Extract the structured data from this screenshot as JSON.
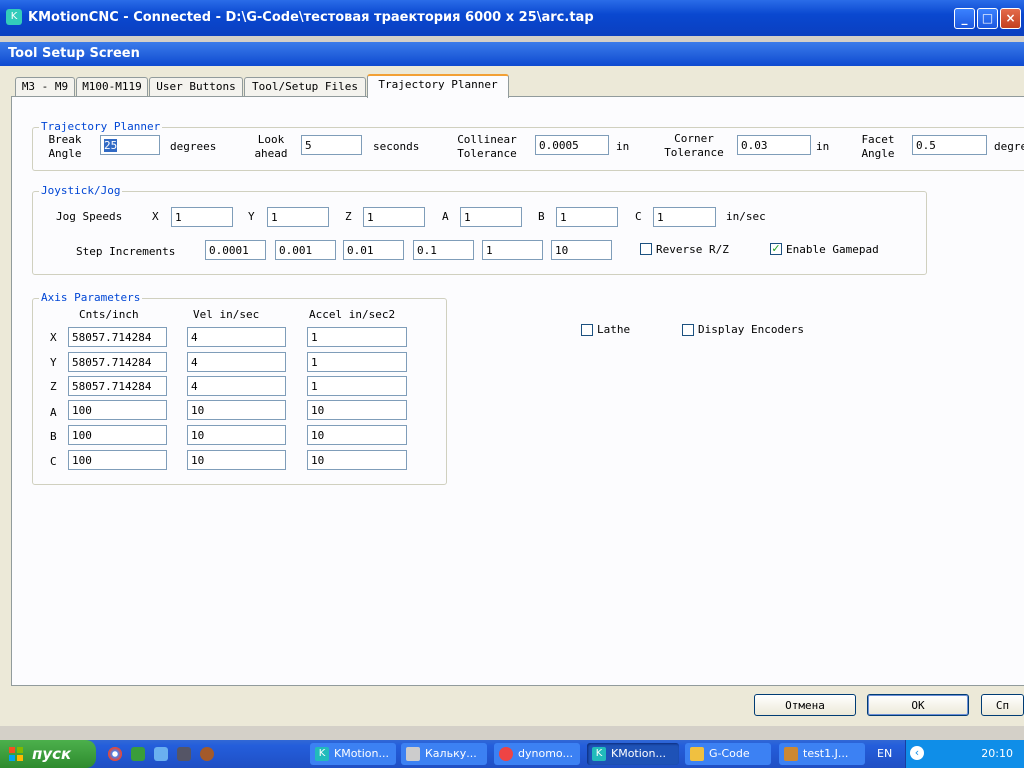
{
  "window": {
    "title": "KMotionCNC - Connected - D:\\G-Code\\тестовая траектория 6000 x 25\\arc.tap"
  },
  "dialog": {
    "title": "Tool Setup Screen"
  },
  "tabs": [
    "M3 - M9",
    "M100-M119",
    "User Buttons",
    "Tool/Setup Files",
    "Trajectory Planner"
  ],
  "trajectory": {
    "group_label": "Trajectory Planner",
    "break_angle_label": "Break\nAngle",
    "break_angle": "25",
    "break_angle_unit": "degrees",
    "look_ahead_label": "Look\nahead",
    "look_ahead": "5",
    "look_ahead_unit": "seconds",
    "collinear_label": "Collinear\nTolerance",
    "collinear": "0.0005",
    "collinear_unit": "in",
    "corner_label": "Corner\nTolerance",
    "corner": "0.03",
    "corner_unit": "in",
    "facet_label": "Facet\nAngle",
    "facet": "0.5",
    "facet_unit": "degrees"
  },
  "joystick": {
    "group_label": "Joystick/Jog",
    "jog_speeds_label": "Jog Speeds",
    "axes": [
      "X",
      "Y",
      "Z",
      "A",
      "B",
      "C"
    ],
    "speeds": [
      "1",
      "1",
      "1",
      "1",
      "1",
      "1"
    ],
    "speed_unit": "in/sec",
    "step_label": "Step Increments",
    "steps": [
      "0.0001",
      "0.001",
      "0.01",
      "0.1",
      "1",
      "10"
    ],
    "reverse_label": "Reverse R/Z",
    "reverse_checked": false,
    "gamepad_label": "Enable Gamepad",
    "gamepad_checked": true
  },
  "axis_params": {
    "group_label": "Axis Parameters",
    "col_cnts": "Cnts/inch",
    "col_vel": "Vel in/sec",
    "col_accel": "Accel in/sec2",
    "rows": [
      {
        "axis": "X",
        "cnts": "58057.714284",
        "vel": "4",
        "accel": "1"
      },
      {
        "axis": "Y",
        "cnts": "58057.714284",
        "vel": "4",
        "accel": "1"
      },
      {
        "axis": "Z",
        "cnts": "58057.714284",
        "vel": "4",
        "accel": "1"
      },
      {
        "axis": "A",
        "cnts": "100",
        "vel": "10",
        "accel": "10"
      },
      {
        "axis": "B",
        "cnts": "100",
        "vel": "10",
        "accel": "10"
      },
      {
        "axis": "C",
        "cnts": "100",
        "vel": "10",
        "accel": "10"
      }
    ]
  },
  "options": {
    "lathe_label": "Lathe",
    "lathe_checked": false,
    "encoders_label": "Display Encoders",
    "encoders_checked": false
  },
  "buttons": {
    "cancel": "Отмена",
    "ok": "OK",
    "apply": "Сп"
  },
  "taskbar": {
    "start": "пуск",
    "tasks": [
      "KMotion...",
      "Кальку...",
      "dynomo...",
      "KMotion...",
      "G-Code",
      "test1.J..."
    ],
    "lang": "EN",
    "clock": "20:10"
  }
}
